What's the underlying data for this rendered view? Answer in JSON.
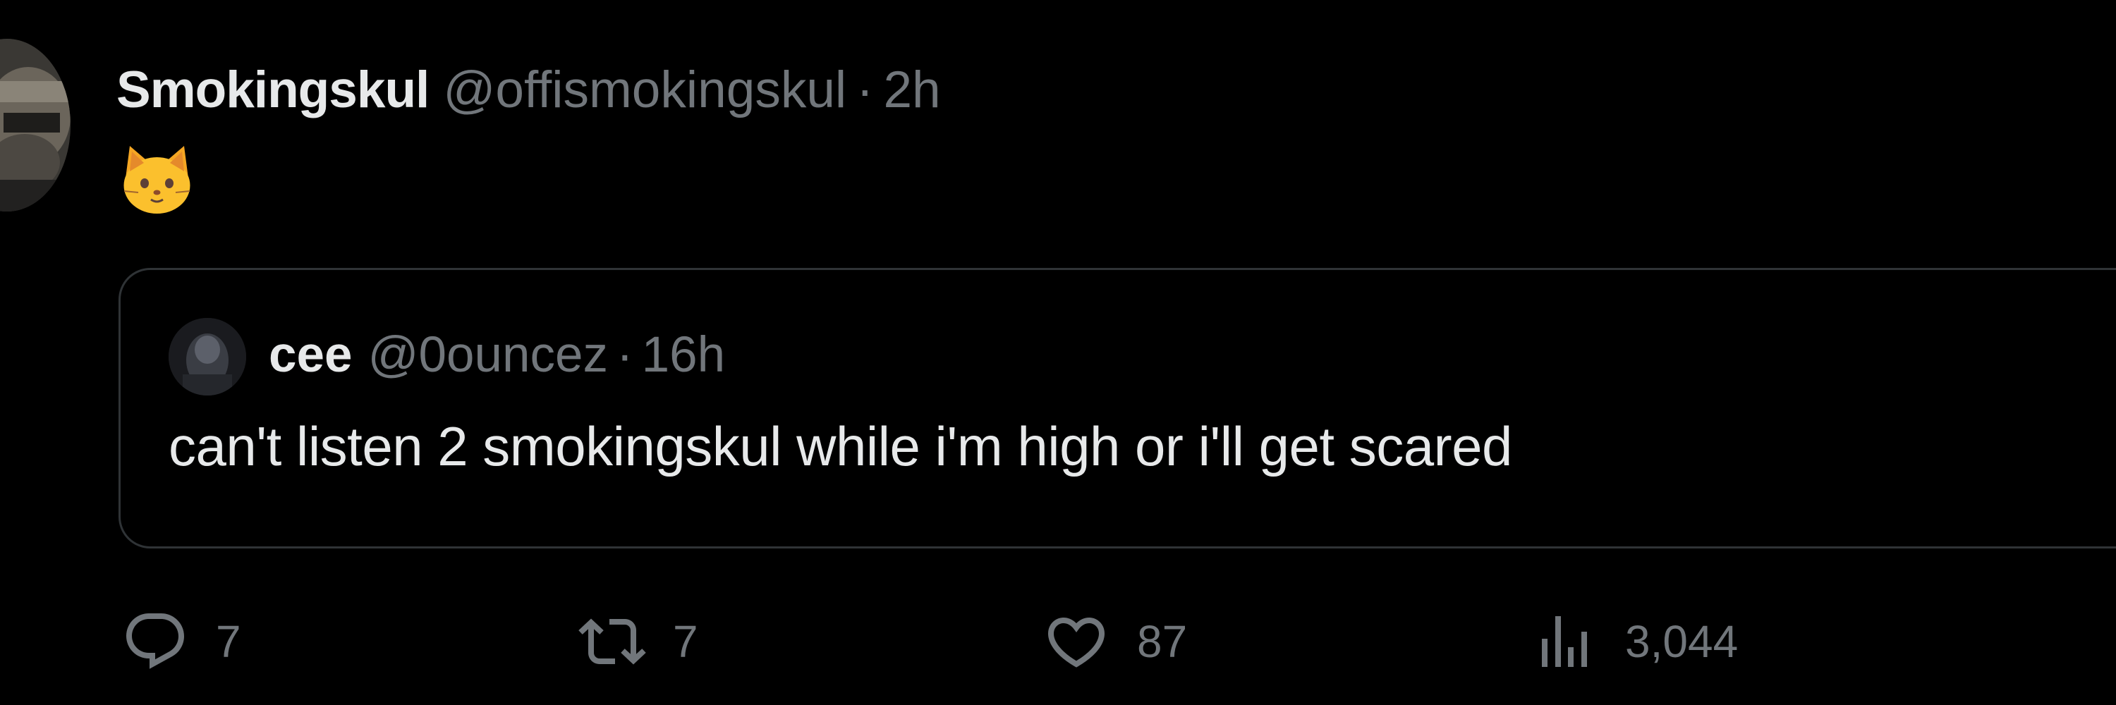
{
  "tweet": {
    "author": {
      "display_name": "Smokingskul",
      "handle": "@offismokingskul"
    },
    "separator": "·",
    "time": "2h",
    "body_emoji": "cat-face-emoji"
  },
  "quoted_tweet": {
    "author": {
      "display_name": "cee",
      "handle": "@0ouncez"
    },
    "separator": "·",
    "time": "16h",
    "text": "can't listen 2 smokingskul while i'm high or i'll get scared"
  },
  "actions": {
    "reply": {
      "icon": "reply-icon",
      "count": "7"
    },
    "retweet": {
      "icon": "retweet-icon",
      "count": "7"
    },
    "like": {
      "icon": "heart-icon",
      "count": "87"
    },
    "views": {
      "icon": "views-icon",
      "count": "3,044"
    }
  },
  "colors": {
    "background": "#000000",
    "primary_text": "#e7e9ea",
    "secondary_text": "#71767b",
    "border": "#2f3336"
  }
}
